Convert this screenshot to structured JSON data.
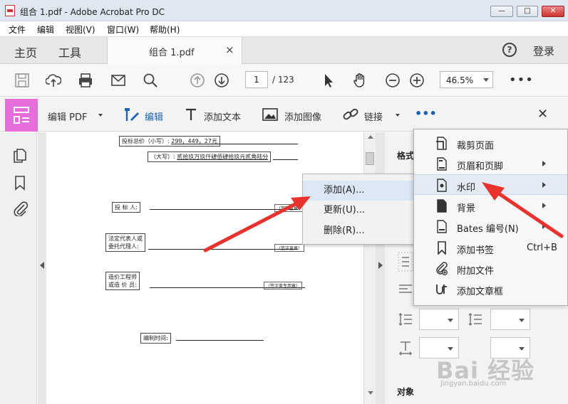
{
  "window": {
    "title": "组合 1.pdf - Adobe Acrobat Pro DC",
    "minimize": "—",
    "maximize": "□",
    "close": "✕"
  },
  "menubar": [
    "文件",
    "编辑",
    "视图(V)",
    "窗口(W)",
    "帮助(H)"
  ],
  "tabs": {
    "home": "主页",
    "tools": "工具",
    "document": "组合 1.pdf",
    "close": "×",
    "login": "登录",
    "help": "?"
  },
  "toolbar": {
    "page_current": "1",
    "page_total": "/ 123",
    "zoom": "46.5%",
    "more": "•••"
  },
  "edit_toolbar": {
    "edit_pdf": "编辑 PDF",
    "edit": "编辑",
    "add_text": "添加文本",
    "add_image": "添加图像",
    "link": "链接",
    "more": "•••",
    "close": "✕"
  },
  "document": {
    "bid_total_label": "投标总价（小写）:",
    "bid_total_value": "299，449，27元",
    "bid_total_upper_label": "（大写）:",
    "bid_total_upper_value": "贰拾玖万玖仟肆佰肆拾玖元贰角陆分",
    "bidder_label": "投 标 人:",
    "bidder_seal": "（签字盖章）",
    "legal_rep_label_1": "法定代表人或",
    "legal_rep_label_2": "委托代理人:",
    "legal_rep_seal": "（签字盖章）",
    "cost_engineer_label_1": "造价工程师",
    "cost_engineer_label_2": "或造 价 员:",
    "cost_engineer_seal": "（签字盖专用章）",
    "prep_time_label": "编制时间:"
  },
  "right_panel": {
    "format_header": "格式",
    "object_header": "对象"
  },
  "watermark_submenu": [
    {
      "label": "添加(A)...",
      "highlighted": true
    },
    {
      "label": "更新(U)...",
      "highlighted": false
    },
    {
      "label": "删除(R)...",
      "highlighted": false
    }
  ],
  "more_menu": [
    {
      "label": "裁剪页面",
      "icon": "crop-icon",
      "submenu": false,
      "shortcut": ""
    },
    {
      "label": "页眉和页脚",
      "icon": "header-footer-icon",
      "submenu": true,
      "shortcut": ""
    },
    {
      "label": "水印",
      "icon": "watermark-icon",
      "submenu": true,
      "shortcut": "",
      "highlighted": true
    },
    {
      "label": "背景",
      "icon": "background-icon",
      "submenu": true,
      "shortcut": ""
    },
    {
      "label": "Bates 编号(N)",
      "icon": "bates-icon",
      "submenu": true,
      "shortcut": ""
    },
    {
      "label": "添加书签",
      "icon": "bookmark-icon",
      "submenu": false,
      "shortcut": "Ctrl+B"
    },
    {
      "label": "附加文件",
      "icon": "attach-icon",
      "submenu": false,
      "shortcut": ""
    },
    {
      "label": "添加文章框",
      "icon": "article-icon",
      "submenu": false,
      "shortcut": ""
    }
  ],
  "watermark_brand": {
    "main": "Bai 经验",
    "sub": "jingyan.baidu.com"
  },
  "colors": {
    "accent_pink": "#e66edb",
    "edit_blue": "#1a63b6",
    "arrow_red": "#e8322e"
  }
}
